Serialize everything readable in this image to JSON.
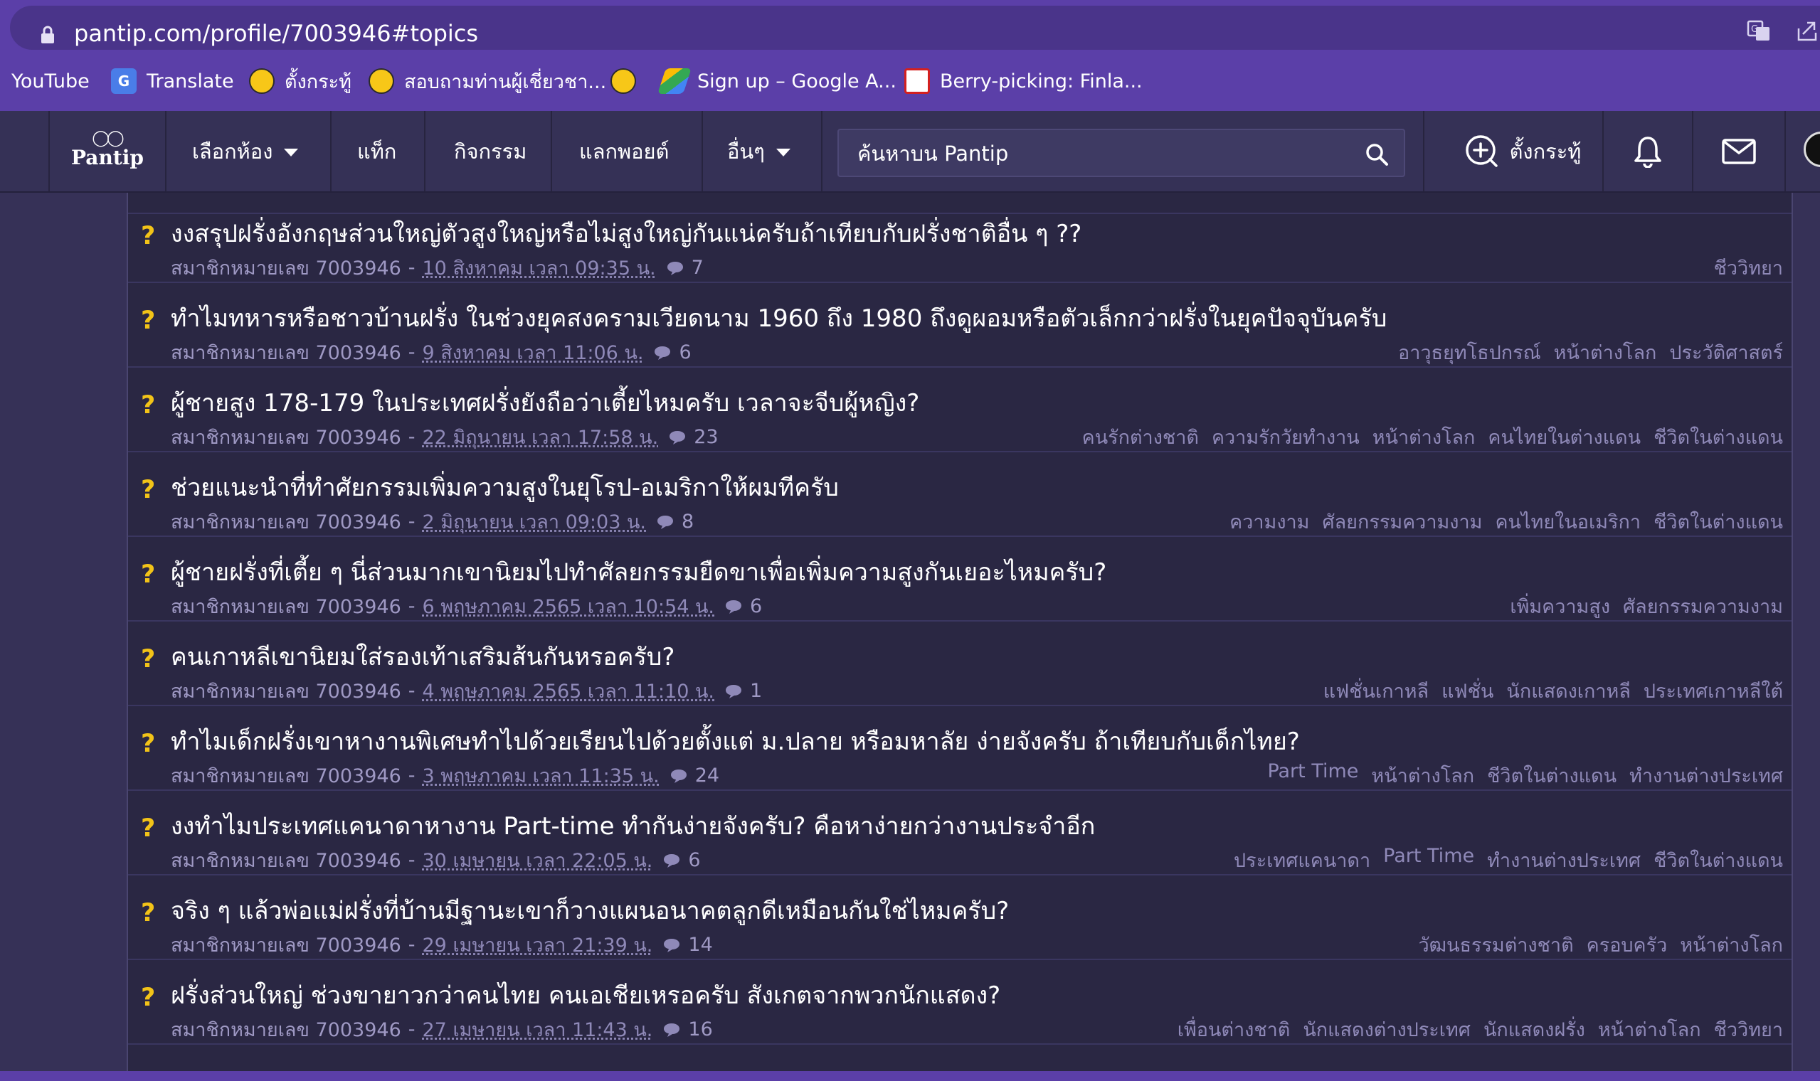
{
  "browser": {
    "url": "pantip.com/profile/7003946#topics",
    "bookmarks": [
      {
        "label": "YouTube",
        "icon": "none"
      },
      {
        "label": "Translate",
        "icon": "google-translate-icon"
      },
      {
        "label": "ตั้งกระทู้",
        "icon": "pantip-emoji-icon"
      },
      {
        "label": "สอบถามท่านผู้เชี่ยวชา...",
        "icon": "pantip-emoji-icon"
      },
      {
        "label": "",
        "icon": "pantip-emoji-icon"
      },
      {
        "label": "Sign up – Google A...",
        "icon": "google-ads-icon"
      },
      {
        "label": "Berry-picking: Finla...",
        "icon": "news-site-icon"
      }
    ]
  },
  "navbar": {
    "logo_text": "Pantip",
    "items": [
      {
        "label": "เลือกห้อง",
        "has_caret": true
      },
      {
        "label": "แท็ก",
        "has_caret": false
      },
      {
        "label": "กิจกรรม",
        "has_caret": false
      },
      {
        "label": "แลกพอยต์",
        "has_caret": false
      },
      {
        "label": "อื่นๆ",
        "has_caret": true
      }
    ],
    "search_placeholder": "ค้นหาบน Pantip",
    "new_topic_label": "ตั้งกระทู้"
  },
  "colors": {
    "accent_purple": "#5b3fa8",
    "navbar_bg": "#353156",
    "panel_bg": "#2a2743",
    "question_mark": "#f2c318",
    "tag_text": "#8f89b8"
  },
  "topics": [
    {
      "title": "งงสรุปฝรั่งอังกฤษส่วนใหญ่ตัวสูงใหญ่หรือไม่สูงใหญ่กันแน่ครับถ้าเทียบกับฝรั่งชาติอื่น ๆ ??",
      "author": "สมาชิกหมายเลข 7003946",
      "date": "10 สิงหาคม เวลา 09:35 น.",
      "comments": "7",
      "tags": [
        "ชีววิทยา"
      ]
    },
    {
      "title": "ทำไมทหารหรือชาวบ้านฝรั่ง ในช่วงยุคสงครามเวียดนาม 1960 ถึง 1980 ถึงดูผอมหรือตัวเล็กกว่าฝรั่งในยุคปัจจุบันครับ",
      "author": "สมาชิกหมายเลข 7003946",
      "date": "9 สิงหาคม เวลา 11:06 น.",
      "comments": "6",
      "tags": [
        "อาวุธยุทโธปกรณ์",
        "หน้าต่างโลก",
        "ประวัติศาสตร์"
      ]
    },
    {
      "title": "ผู้ชายสูง 178-179 ในประเทศฝรั่งยังถือว่าเตี้ยไหมครับ เวลาจะจีบผู้หญิง?",
      "author": "สมาชิกหมายเลข 7003946",
      "date": "22 มิถุนายน เวลา 17:58 น.",
      "comments": "23",
      "tags": [
        "คนรักต่างชาติ",
        "ความรักวัยทำงาน",
        "หน้าต่างโลก",
        "คนไทยในต่างแดน",
        "ชีวิตในต่างแดน"
      ]
    },
    {
      "title": "ช่วยแนะนำที่ทำศัยกรรมเพิ่มความสูงในยุโรป-อเมริกาให้ผมทีครับ",
      "author": "สมาชิกหมายเลข 7003946",
      "date": "2 มิถุนายน เวลา 09:03 น.",
      "comments": "8",
      "tags": [
        "ความงาม",
        "ศัลยกรรมความงาม",
        "คนไทยในอเมริกา",
        "ชีวิตในต่างแดน"
      ]
    },
    {
      "title": "ผู้ชายฝรั่งที่เตี้ย ๆ นี่ส่วนมากเขานิยมไปทำศัลยกรรมยืดขาเพื่อเพิ่มความสูงกันเยอะไหมครับ?",
      "author": "สมาชิกหมายเลข 7003946",
      "date": "6 พฤษภาคม 2565 เวลา 10:54 น.",
      "comments": "6",
      "tags": [
        "เพิ่มความสูง",
        "ศัลยกรรมความงาม"
      ]
    },
    {
      "title": "คนเกาหลีเขานิยมใส่รองเท้าเสริมส้นกันหรอครับ?",
      "author": "สมาชิกหมายเลข 7003946",
      "date": "4 พฤษภาคม 2565 เวลา 11:10 น.",
      "comments": "1",
      "tags": [
        "แฟชั่นเกาหลี",
        "แฟชั่น",
        "นักแสดงเกาหลี",
        "ประเทศเกาหลีใต้"
      ]
    },
    {
      "title": "ทำไมเด็กฝรั่งเขาหางานพิเศษทำไปด้วยเรียนไปด้วยตั้งแต่ ม.ปลาย หรือมหาลัย ง่ายจังครับ ถ้าเทียบกับเด็กไทย?",
      "author": "สมาชิกหมายเลข 7003946",
      "date": "3 พฤษภาคม เวลา 11:35 น.",
      "comments": "24",
      "tags": [
        "Part Time",
        "หน้าต่างโลก",
        "ชีวิตในต่างแดน",
        "ทำงานต่างประเทศ"
      ]
    },
    {
      "title": "งงทำไมประเทศแคนาดาหางาน Part-time ทำกันง่ายจังครับ? คือหาง่ายกว่างานประจำอีก",
      "author": "สมาชิกหมายเลข 7003946",
      "date": "30 เมษายน เวลา 22:05 น.",
      "comments": "6",
      "tags": [
        "ประเทศแคนาดา",
        "Part Time",
        "ทำงานต่างประเทศ",
        "ชีวิตในต่างแดน"
      ]
    },
    {
      "title": "จริง ๆ แล้วพ่อแม่ฝรั่งที่บ้านมีฐานะเขาก็วางแผนอนาคตลูกดีเหมือนกันใช่ไหมครับ?",
      "author": "สมาชิกหมายเลข 7003946",
      "date": "29 เมษายน เวลา 21:39 น.",
      "comments": "14",
      "tags": [
        "วัฒนธรรมต่างชาติ",
        "ครอบครัว",
        "หน้าต่างโลก"
      ]
    },
    {
      "title": "ฝรั่งส่วนใหญ่ ช่วงขายาวกว่าคนไทย คนเอเชียเหรอครับ สังเกตจากพวกนักแสดง?",
      "author": "สมาชิกหมายเลข 7003946",
      "date": "27 เมษายน เวลา 11:43 น.",
      "comments": "16",
      "tags": [
        "เพื่อนต่างชาติ",
        "นักแสดงต่างประเทศ",
        "นักแสดงฝรั่ง",
        "หน้าต่างโลก",
        "ชีววิทยา"
      ]
    }
  ]
}
